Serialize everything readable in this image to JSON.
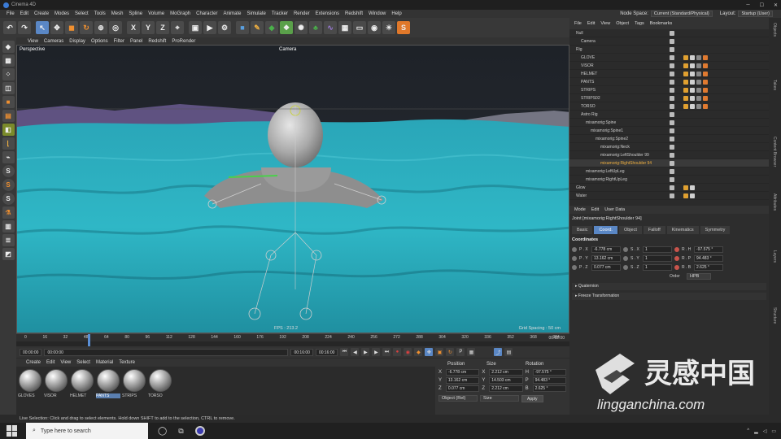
{
  "window": {
    "title": "Cinema 4D"
  },
  "menu": [
    "File",
    "Edit",
    "Create",
    "Modes",
    "Select",
    "Tools",
    "Mesh",
    "Spline",
    "Volume",
    "MoGraph",
    "Character",
    "Animate",
    "Simulate",
    "Tracker",
    "Render",
    "Extensions",
    "Redshift",
    "Window",
    "Help"
  ],
  "nodespace": {
    "label": "Node Space:",
    "value": "Current (Standard/Physical)",
    "layout_label": "Layout:",
    "layout_value": "Startup (User)"
  },
  "viewport": {
    "menu": [
      "View",
      "Cameras",
      "Display",
      "Options",
      "Filter",
      "Panel",
      "Redshift",
      "ProRender"
    ],
    "label": "Perspective",
    "camera": "Camera",
    "fps": "FPS : 213.2",
    "grid": "Grid Spacing : 50 cm"
  },
  "timeline": {
    "ticks": [
      "0",
      "16",
      "32",
      "48",
      "64",
      "80",
      "96",
      "112",
      "128",
      "144",
      "160",
      "176",
      "192",
      "208",
      "224",
      "240",
      "256",
      "272",
      "288",
      "304",
      "320",
      "336",
      "352",
      "368",
      "384"
    ],
    "end": "0 F",
    "current": "48",
    "end_readout": "00:02:00"
  },
  "transport": {
    "start": "00:00:00",
    "current": "00:00:00",
    "min": "00:16:00",
    "max": "00:16:00"
  },
  "materials": {
    "menu": [
      "Create",
      "Edit",
      "View",
      "Select",
      "Material",
      "Texture"
    ],
    "items": [
      "GLOVES",
      "VISOR",
      "HELMET",
      "PANTS",
      "STRIPS",
      "TORSO"
    ],
    "selected": "PANTS"
  },
  "coords": {
    "headers": [
      "Position",
      "Size",
      "Rotation"
    ],
    "rows": [
      {
        "axis": "X",
        "pos": "-6.778 cm",
        "size": "2.212 cm",
        "rlab": "H",
        "rot": "-97.575 °"
      },
      {
        "axis": "Y",
        "pos": "13.162 cm",
        "size": "14.503 cm",
        "rlab": "P",
        "rot": "94.483 °"
      },
      {
        "axis": "Z",
        "pos": "0.077 cm",
        "size": "2.212 cm",
        "rlab": "B",
        "rot": "2.625 °"
      }
    ],
    "mode": "Object (Rel)",
    "size_mode": "Size",
    "apply": "Apply"
  },
  "object_manager": {
    "menu": [
      "File",
      "Edit",
      "View",
      "Object",
      "Tags",
      "Bookmarks"
    ],
    "items": [
      {
        "name": "Null",
        "indent": 0,
        "tags": 0
      },
      {
        "name": "Camera",
        "indent": 1,
        "tags": 0
      },
      {
        "name": "Rig",
        "indent": 0,
        "tags": 0
      },
      {
        "name": "GLOVE",
        "indent": 1,
        "tags": 4
      },
      {
        "name": "VISOR",
        "indent": 1,
        "tags": 4
      },
      {
        "name": "HELMET",
        "indent": 1,
        "tags": 4
      },
      {
        "name": "PANTS",
        "indent": 1,
        "tags": 4
      },
      {
        "name": "STRIPS",
        "indent": 1,
        "tags": 4
      },
      {
        "name": "STRIPS02",
        "indent": 1,
        "tags": 4
      },
      {
        "name": "TORSO",
        "indent": 1,
        "tags": 4
      },
      {
        "name": "Astro Rig",
        "indent": 1,
        "tags": 0
      },
      {
        "name": "mixamorig:Spine",
        "indent": 2,
        "tags": 0
      },
      {
        "name": "mixamorig:Spine1",
        "indent": 3,
        "tags": 0
      },
      {
        "name": "mixamorig:Spine2",
        "indent": 4,
        "tags": 0
      },
      {
        "name": "mixamorig:Neck",
        "indent": 5,
        "tags": 0
      },
      {
        "name": "mixamorig:LeftShoulder 99",
        "indent": 5,
        "tags": 0
      },
      {
        "name": "mixamorig:RightShoulder 94",
        "indent": 5,
        "tags": 0,
        "selected": true
      },
      {
        "name": "mixamorig:LeftUpLeg",
        "indent": 2,
        "tags": 0
      },
      {
        "name": "mixamorig:RightUpLeg",
        "indent": 2,
        "tags": 0
      },
      {
        "name": "Glow",
        "indent": 0,
        "tags": 2
      },
      {
        "name": "Water",
        "indent": 0,
        "tags": 2
      }
    ]
  },
  "attributes": {
    "menu": [
      "Mode",
      "Edit",
      "User Data"
    ],
    "title": "Joint [mixamorig:RightShoulder 94]",
    "tabs": [
      "Basic",
      "Coord.",
      "Object",
      "Falloff",
      "Kinematics",
      "Symmetry"
    ],
    "active_tab": "Coord.",
    "section": "Coordinates",
    "rows": [
      {
        "p": "P . X",
        "pv": "-6.778 cm",
        "s": "S . X",
        "sv": "1",
        "r": "R . H",
        "rv": "-97.575 °"
      },
      {
        "p": "P . Y",
        "pv": "13.162 cm",
        "s": "S . Y",
        "sv": "1",
        "r": "R . P",
        "rv": "94.483 °"
      },
      {
        "p": "P . Z",
        "pv": "0.077 cm",
        "s": "S . Z",
        "sv": "1",
        "r": "R . B",
        "rv": "2.625 °"
      }
    ],
    "order_label": "Order",
    "order_value": "HPB",
    "quaternion": "Quaternion",
    "freeze": "Freeze Transformation"
  },
  "right_strip": [
    "Objects",
    "Takes",
    "Content Browser",
    "Attributes",
    "Layers",
    "Structure"
  ],
  "status": "Live Selection: Click and drag to select elements. Hold down SHIFT to add to the selection, CTRL to remove.",
  "taskbar": {
    "search": "Type here to search"
  },
  "watermark": {
    "cn": "灵感中国",
    "url": "lingganchina.com"
  },
  "colors": {
    "accent": "#5a87c5",
    "water": "#2fb3c4",
    "selected_text": "#f0b040"
  }
}
